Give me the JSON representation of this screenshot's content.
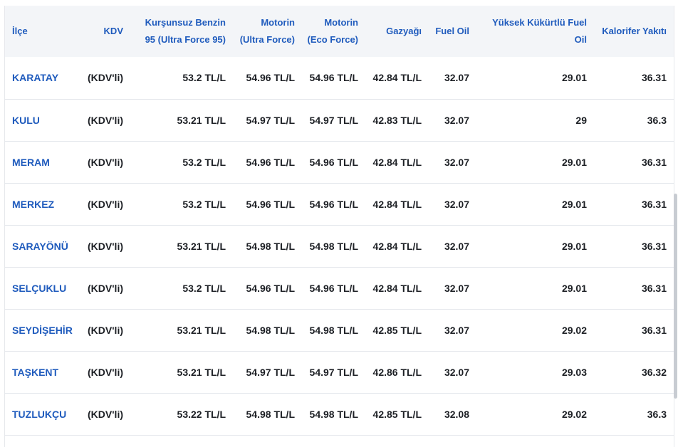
{
  "table": {
    "headers": {
      "ilce": "İlçe",
      "kdv": "KDV",
      "benzin": "Kurşunsuz Benzin 95 (Ultra Force 95)",
      "motorin_ultra": "Motorin (Ultra Force)",
      "motorin_eco": "Motorin (Eco Force)",
      "gazyagi": "Gazyağı",
      "fuel_oil": "Fuel Oil",
      "yuksek_kukurtlu": "Yüksek Kükürtlü Fuel Oil",
      "kalorifer": "Kalorifer Yakıtı"
    },
    "rows": [
      {
        "ilce": "KARATAY",
        "kdv": "(KDV'li)",
        "benzin": "53.2 TL/L",
        "motorin_ultra": "54.96 TL/L",
        "motorin_eco": "54.96 TL/L",
        "gazyagi": "42.84 TL/L",
        "fuel_oil": "32.07",
        "yuksek_kukurtlu": "29.01",
        "kalorifer": "36.31"
      },
      {
        "ilce": "KULU",
        "kdv": "(KDV'li)",
        "benzin": "53.21 TL/L",
        "motorin_ultra": "54.97 TL/L",
        "motorin_eco": "54.97 TL/L",
        "gazyagi": "42.83 TL/L",
        "fuel_oil": "32.07",
        "yuksek_kukurtlu": "29",
        "kalorifer": "36.3"
      },
      {
        "ilce": "MERAM",
        "kdv": "(KDV'li)",
        "benzin": "53.2 TL/L",
        "motorin_ultra": "54.96 TL/L",
        "motorin_eco": "54.96 TL/L",
        "gazyagi": "42.84 TL/L",
        "fuel_oil": "32.07",
        "yuksek_kukurtlu": "29.01",
        "kalorifer": "36.31"
      },
      {
        "ilce": "MERKEZ",
        "kdv": "(KDV'li)",
        "benzin": "53.2 TL/L",
        "motorin_ultra": "54.96 TL/L",
        "motorin_eco": "54.96 TL/L",
        "gazyagi": "42.84 TL/L",
        "fuel_oil": "32.07",
        "yuksek_kukurtlu": "29.01",
        "kalorifer": "36.31"
      },
      {
        "ilce": "SARAYÖNÜ",
        "kdv": "(KDV'li)",
        "benzin": "53.21 TL/L",
        "motorin_ultra": "54.98 TL/L",
        "motorin_eco": "54.98 TL/L",
        "gazyagi": "42.84 TL/L",
        "fuel_oil": "32.07",
        "yuksek_kukurtlu": "29.01",
        "kalorifer": "36.31"
      },
      {
        "ilce": "SELÇUKLU",
        "kdv": "(KDV'li)",
        "benzin": "53.2 TL/L",
        "motorin_ultra": "54.96 TL/L",
        "motorin_eco": "54.96 TL/L",
        "gazyagi": "42.84 TL/L",
        "fuel_oil": "32.07",
        "yuksek_kukurtlu": "29.01",
        "kalorifer": "36.31"
      },
      {
        "ilce": "SEYDİŞEHİR",
        "kdv": "(KDV'li)",
        "benzin": "53.21 TL/L",
        "motorin_ultra": "54.98 TL/L",
        "motorin_eco": "54.98 TL/L",
        "gazyagi": "42.85 TL/L",
        "fuel_oil": "32.07",
        "yuksek_kukurtlu": "29.02",
        "kalorifer": "36.31"
      },
      {
        "ilce": "TAŞKENT",
        "kdv": "(KDV'li)",
        "benzin": "53.21 TL/L",
        "motorin_ultra": "54.97 TL/L",
        "motorin_eco": "54.97 TL/L",
        "gazyagi": "42.86 TL/L",
        "fuel_oil": "32.07",
        "yuksek_kukurtlu": "29.03",
        "kalorifer": "36.32"
      },
      {
        "ilce": "TUZLUKÇU",
        "kdv": "(KDV'li)",
        "benzin": "53.22 TL/L",
        "motorin_ultra": "54.98 TL/L",
        "motorin_eco": "54.98 TL/L",
        "gazyagi": "42.85 TL/L",
        "fuel_oil": "32.08",
        "yuksek_kukurtlu": "29.02",
        "kalorifer": "36.3"
      }
    ]
  },
  "colors": {
    "accent": "#1f5bbd",
    "header_bg": "#f3f5f8",
    "row_border": "#e3e6eb",
    "text": "#1c1f24",
    "scrollbar": "#c8ccd2"
  }
}
